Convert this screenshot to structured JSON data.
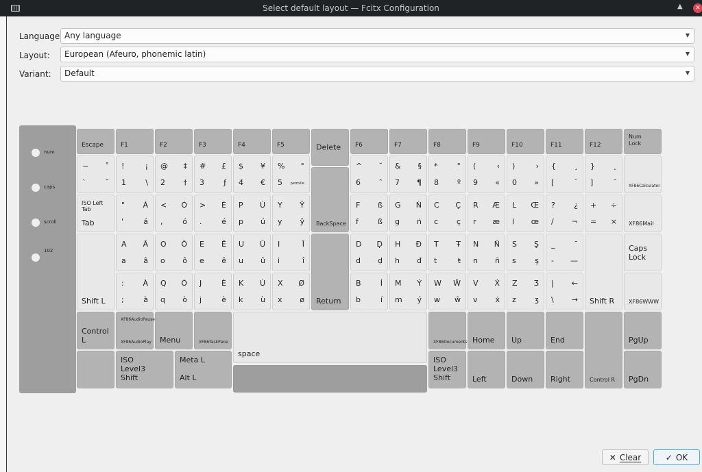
{
  "window": {
    "title": "Select default layout — Fcitx Configuration",
    "app_icon": "keyboard-icon",
    "close_glyph": "✕",
    "keep_above_glyph": "▲"
  },
  "form": {
    "language": {
      "label": "Language:",
      "value": "Any language"
    },
    "layout": {
      "label": "Layout:",
      "value": "European (Afeuro, phonemic latin)"
    },
    "variant": {
      "label": "Variant:",
      "value": "Default"
    }
  },
  "indicators": [
    "num",
    "caps",
    "scroll",
    "102"
  ],
  "colors": {
    "light_key": "#e8e8e8",
    "dark_key": "#b3b3b3",
    "panel": "#9e9e9e",
    "accent": "#3daee9"
  },
  "keys": [
    {
      "label": "Escape"
    },
    {
      "label": "F1"
    },
    {
      "label": "F2"
    },
    {
      "label": "F3"
    },
    {
      "label": "F4"
    },
    {
      "label": "F5"
    },
    {
      "label": "Delete"
    },
    {
      "label": "F6"
    },
    {
      "label": "F7"
    },
    {
      "label": "F8"
    },
    {
      "label": "F9"
    },
    {
      "label": "F10"
    },
    {
      "label": "F11"
    },
    {
      "label": "F12"
    },
    {
      "label": "Num\nLock"
    },
    {
      "tl": "~",
      "tr": "˚",
      "bl": "`",
      "br": "˜"
    },
    {
      "tl": "!",
      "tr": "¡",
      "bl": "1",
      "br": "\\"
    },
    {
      "tl": "@",
      "tr": "‡",
      "bl": "2",
      "br": "†"
    },
    {
      "tl": "#",
      "tr": "£",
      "bl": "3",
      "br": "ƒ"
    },
    {
      "tl": "$",
      "tr": "¥",
      "bl": "4",
      "br": "€"
    },
    {
      "tl": "%",
      "tr": "°",
      "bl": "5",
      "br": "permille"
    },
    {
      "tl": "^",
      "tr": "˘",
      "bl": "6",
      "br": "ˆ"
    },
    {
      "tl": "&",
      "tr": "§",
      "bl": "7",
      "br": "¶"
    },
    {
      "tl": "*",
      "tr": "°",
      "bl": "8",
      "br": "º"
    },
    {
      "tl": "(",
      "tr": "‹",
      "bl": "9",
      "br": "«"
    },
    {
      "tl": ")",
      "tr": "›",
      "bl": "0",
      "br": "»"
    },
    {
      "tl": "{",
      "tr": "¸",
      "bl": "[",
      "br": "¨"
    },
    {
      "tl": "}",
      "tr": "˛",
      "bl": "]",
      "br": "¯"
    },
    {
      "label": "XF86Calculator"
    },
    {
      "sub": "ISO Left Tab",
      "label": "Tab"
    },
    {
      "tl": "\"",
      "tr": "Á",
      "bl": "'",
      "br": "á"
    },
    {
      "tl": "<",
      "tr": "Ó",
      "bl": ",",
      "br": "ó"
    },
    {
      "tl": ">",
      "tr": "É",
      "bl": ".",
      "br": "é"
    },
    {
      "tl": "P",
      "tr": "Ú",
      "bl": "p",
      "br": "ú"
    },
    {
      "tl": "Y",
      "tr": "Ŷ",
      "bl": "y",
      "br": "ŷ"
    },
    {
      "label": "BackSpace"
    },
    {
      "tl": "F",
      "tr": "ß",
      "bl": "f",
      "br": "ß"
    },
    {
      "tl": "G",
      "tr": "Ṅ",
      "bl": "g",
      "br": "ṅ"
    },
    {
      "tl": "C",
      "tr": "Ç",
      "bl": "c",
      "br": "ç"
    },
    {
      "tl": "R",
      "tr": "Æ",
      "bl": "r",
      "br": "æ"
    },
    {
      "tl": "L",
      "tr": "Œ",
      "bl": "l",
      "br": "œ"
    },
    {
      "tl": "?",
      "tr": "¿",
      "bl": "/",
      "br": "¬"
    },
    {
      "tl": "+",
      "tr": "÷",
      "bl": "=",
      "br": "×"
    },
    {
      "label": "XF86Mail"
    },
    {
      "label": "Shift L"
    },
    {
      "tl": "A",
      "tr": "Â",
      "bl": "a",
      "br": "â"
    },
    {
      "tl": "O",
      "tr": "Ô",
      "bl": "o",
      "br": "ô"
    },
    {
      "tl": "E",
      "tr": "Ê",
      "bl": "e",
      "br": "ê"
    },
    {
      "tl": "U",
      "tr": "Û",
      "bl": "u",
      "br": "û"
    },
    {
      "tl": "I",
      "tr": "Î",
      "bl": "i",
      "br": "î"
    },
    {
      "label": "Return"
    },
    {
      "tl": "D",
      "tr": "Ḍ",
      "bl": "d",
      "br": "ḍ"
    },
    {
      "tl": "H",
      "tr": "Đ",
      "bl": "h",
      "br": "đ"
    },
    {
      "tl": "T",
      "tr": "Ŧ",
      "bl": "t",
      "br": "ŧ"
    },
    {
      "tl": "N",
      "tr": "Ñ",
      "bl": "n",
      "br": "ñ"
    },
    {
      "tl": "S",
      "tr": "Ş",
      "bl": "s",
      "br": "ş"
    },
    {
      "tl": "_",
      "tr": "¯",
      "bl": "-",
      "br": "—"
    },
    {
      "label": "Shift R"
    },
    {
      "label": "Caps\nLock"
    },
    {
      "tl": ":",
      "tr": "À",
      "bl": ";",
      "br": "à"
    },
    {
      "tl": "Q",
      "tr": "Ò",
      "bl": "q",
      "br": "ò"
    },
    {
      "tl": "J",
      "tr": "È",
      "bl": "j",
      "br": "è"
    },
    {
      "tl": "K",
      "tr": "Ù",
      "bl": "k",
      "br": "ù"
    },
    {
      "tl": "X",
      "tr": "Ø",
      "bl": "x",
      "br": "ø"
    },
    {
      "tl": "B",
      "tr": "Í",
      "bl": "b",
      "br": "í"
    },
    {
      "tl": "M",
      "tr": "Ý",
      "bl": "m",
      "br": "ý"
    },
    {
      "tl": "W",
      "tr": "Ŵ",
      "bl": "w",
      "br": "ŵ"
    },
    {
      "tl": "V",
      "tr": "Ẋ",
      "bl": "v",
      "br": "ẋ"
    },
    {
      "tl": "Z",
      "tr": "Ʒ",
      "bl": "z",
      "br": "ʒ"
    },
    {
      "tl": "|",
      "tr": "←",
      "bl": "\\",
      "br": "→"
    },
    {
      "label": "XF86WWW"
    },
    {
      "label": "Control L"
    },
    {
      "sub": "XF86AudioPause",
      "label": "XF86AudioPlay"
    },
    {
      "label": "Menu"
    },
    {
      "label": "XF86TaskPane"
    },
    {
      "label": "space"
    },
    {
      "label": "XF86Documents"
    },
    {
      "label": "Home"
    },
    {
      "label": "Up"
    },
    {
      "label": "End"
    },
    {
      "label": "Control R"
    },
    {
      "label": "PgUp"
    },
    {
      "label": ""
    },
    {
      "label": "ISO\nLevel3\nShift"
    },
    {
      "label": "Meta L\n\nAlt L"
    },
    {
      "label": ""
    },
    {
      "label": "ISO\nLevel3\nShift"
    },
    {
      "label": "Left"
    },
    {
      "label": "Down"
    },
    {
      "label": "Right"
    },
    {
      "label": "PgDn"
    }
  ],
  "buttons": {
    "clear": {
      "icon": "✕",
      "label": "Clear"
    },
    "ok": {
      "icon": "✓",
      "label": "OK"
    }
  }
}
